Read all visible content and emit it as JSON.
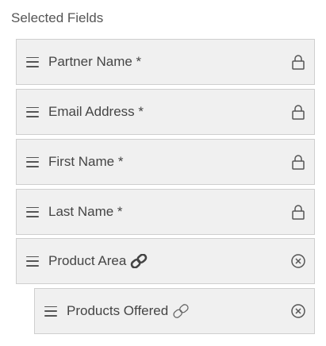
{
  "section": {
    "title": "Selected Fields"
  },
  "fields": [
    {
      "label": "Partner Name *",
      "icon": "lock-icon"
    },
    {
      "label": "Email Address *",
      "icon": "lock-icon"
    },
    {
      "label": "First Name *",
      "icon": "lock-icon"
    },
    {
      "label": "Last Name *",
      "icon": "lock-icon"
    },
    {
      "label": "Product Area",
      "icon": "remove-circle-icon",
      "link_icon": "link-icon",
      "link_style": "solid"
    },
    {
      "label": "Products Offered",
      "icon": "remove-circle-icon",
      "link_icon": "link-icon",
      "link_style": "outline",
      "nested": true
    }
  ],
  "colors": {
    "field_background": "#f0f0f0",
    "field_border": "#cfcfcf",
    "text": "#454545",
    "icon": "#555555"
  }
}
